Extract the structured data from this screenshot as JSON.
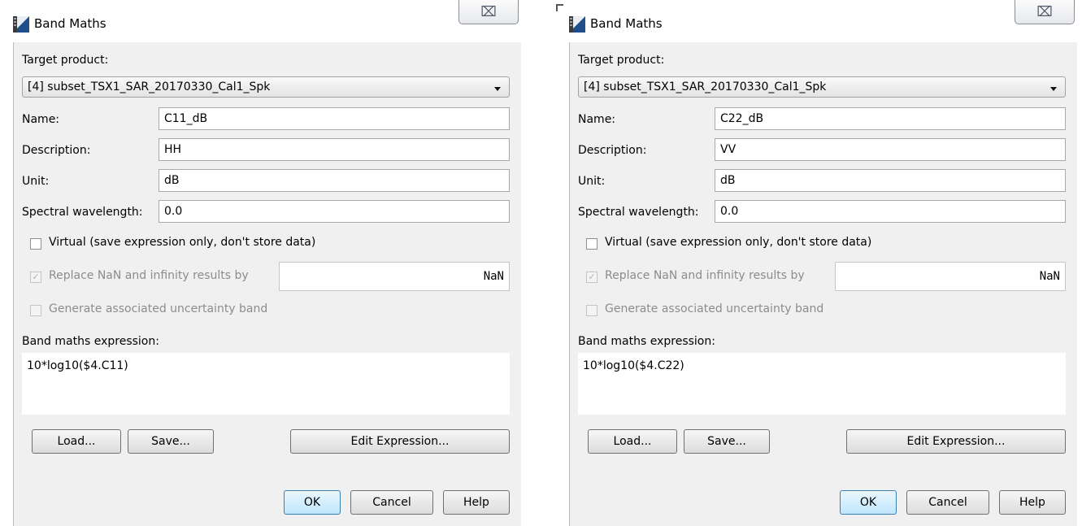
{
  "dialogs": [
    {
      "title": "Band Maths",
      "close_glyph": "⌧",
      "target_product_label": "Target product:",
      "target_product_value": "[4] subset_TSX1_SAR_20170330_Cal1_Spk",
      "name_label": "Name:",
      "name_value": "C11_dB",
      "description_label": "Description:",
      "description_value": "HH",
      "unit_label": "Unit:",
      "unit_value": "dB",
      "spectral_label": "Spectral wavelength:",
      "spectral_value": "0.0",
      "virtual_label": "Virtual (save expression only, don't store data)",
      "replace_nan_label": "Replace NaN and infinity results by",
      "replace_nan_value": "NaN",
      "uncertainty_label": "Generate associated uncertainty band",
      "expression_label": "Band maths expression:",
      "expression_value": "10*log10($4.C11)",
      "load_label": "Load...",
      "save_label": "Save...",
      "edit_expression_label": "Edit Expression...",
      "ok_label": "OK",
      "cancel_label": "Cancel",
      "help_label": "Help"
    },
    {
      "title": "Band Maths",
      "close_glyph": "⌧",
      "target_product_label": "Target product:",
      "target_product_value": "[4] subset_TSX1_SAR_20170330_Cal1_Spk",
      "name_label": "Name:",
      "name_value": "C22_dB",
      "description_label": "Description:",
      "description_value": "VV",
      "unit_label": "Unit:",
      "unit_value": "dB",
      "spectral_label": "Spectral wavelength:",
      "spectral_value": "0.0",
      "virtual_label": "Virtual (save expression only, don't store data)",
      "replace_nan_label": "Replace NaN and infinity results by",
      "replace_nan_value": "NaN",
      "uncertainty_label": "Generate associated uncertainty band",
      "expression_label": "Band maths expression:",
      "expression_value": "10*log10($4.C22)",
      "load_label": "Load...",
      "save_label": "Save...",
      "edit_expression_label": "Edit Expression...",
      "ok_label": "OK",
      "cancel_label": "Cancel",
      "help_label": "Help"
    }
  ],
  "checkbox_states": {
    "virtual_checked": false,
    "replace_nan_checked": true,
    "replace_nan_enabled": false,
    "uncertainty_checked": false,
    "uncertainty_enabled": false
  },
  "icons": [
    "snap-app-icon",
    "close-icon",
    "dropdown-arrow-icon",
    "checkmark-icon"
  ],
  "colors": {
    "dialog_background": "#f0f0f0",
    "default_button": "#bee6fd",
    "disabled_text": "#8c8c8c"
  }
}
